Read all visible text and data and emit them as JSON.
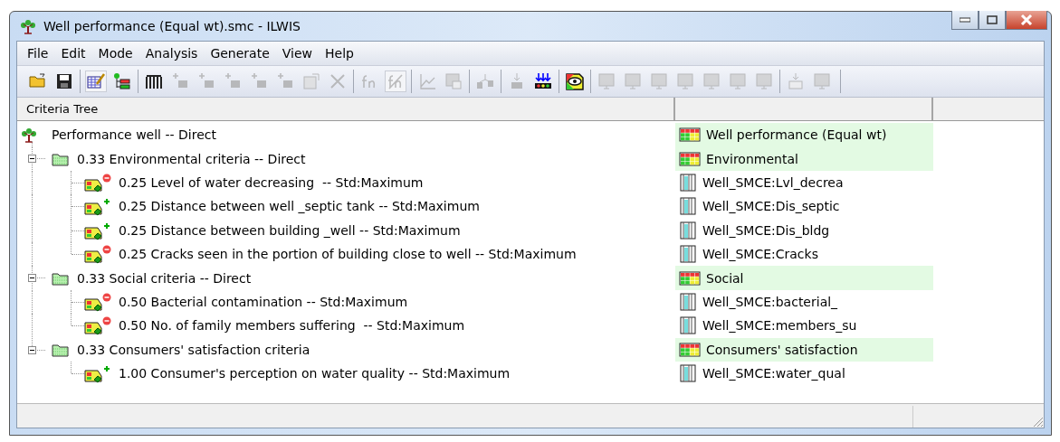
{
  "window": {
    "title": "Well performance (Equal wt).smc - ILWIS"
  },
  "menu": [
    "File",
    "Edit",
    "Mode",
    "Analysis",
    "Generate",
    "View",
    "Help"
  ],
  "toolbar": [
    {
      "buttons": [
        {
          "disabled": false,
          "pressed": false
        },
        {
          "disabled": false,
          "pressed": false
        }
      ]
    },
    {
      "buttons": [
        {
          "disabled": false,
          "pressed": true
        },
        {
          "disabled": false,
          "pressed": false
        }
      ]
    },
    {
      "buttons": [
        {
          "disabled": false,
          "pressed": false
        },
        {
          "disabled": true,
          "pressed": false
        },
        {
          "disabled": true,
          "pressed": false
        },
        {
          "disabled": true,
          "pressed": false
        },
        {
          "disabled": true,
          "pressed": false
        },
        {
          "disabled": true,
          "pressed": false
        },
        {
          "disabled": true,
          "pressed": false
        },
        {
          "disabled": true,
          "pressed": false
        }
      ]
    },
    {
      "buttons": [
        {
          "disabled": true,
          "pressed": false
        },
        {
          "disabled": true,
          "pressed": true
        }
      ]
    },
    {
      "buttons": [
        {
          "disabled": true,
          "pressed": false
        },
        {
          "disabled": true,
          "pressed": false
        }
      ]
    },
    {
      "buttons": [
        {
          "disabled": true,
          "pressed": false
        }
      ]
    },
    {
      "buttons": [
        {
          "disabled": true,
          "pressed": false
        },
        {
          "disabled": false,
          "pressed": false
        }
      ]
    },
    {
      "buttons": [
        {
          "disabled": false,
          "pressed": false
        }
      ]
    },
    {
      "buttons": [
        {
          "disabled": true,
          "pressed": false
        },
        {
          "disabled": true,
          "pressed": false
        },
        {
          "disabled": true,
          "pressed": false
        },
        {
          "disabled": true,
          "pressed": false
        },
        {
          "disabled": true,
          "pressed": false
        },
        {
          "disabled": true,
          "pressed": false
        },
        {
          "disabled": true,
          "pressed": false
        }
      ]
    },
    {
      "buttons": [
        {
          "disabled": true,
          "pressed": false
        },
        {
          "disabled": true,
          "pressed": false
        }
      ]
    }
  ],
  "columns": [
    "Criteria Tree"
  ],
  "tree": {
    "label": "Performance well -- Direct",
    "output": {
      "text": "Well performance (Equal wt)",
      "kind": "map"
    },
    "children": [
      {
        "label": "0.33 Environmental criteria -- Direct",
        "expanded": true,
        "output": {
          "text": "Environmental",
          "kind": "map"
        },
        "children": [
          {
            "label": "0.25 Level of water decreasing  -- Std:Maximum",
            "kind": "cost",
            "output": {
              "text": "Well_SMCE:Lvl_decrea",
              "kind": "column"
            }
          },
          {
            "label": "0.25 Distance between well _septic tank -- Std:Maximum",
            "kind": "benefit",
            "output": {
              "text": "Well_SMCE:Dis_septic",
              "kind": "column"
            }
          },
          {
            "label": "0.25 Distance between building _well -- Std:Maximum",
            "kind": "benefit",
            "output": {
              "text": "Well_SMCE:Dis_bldg",
              "kind": "column"
            }
          },
          {
            "label": "0.25 Cracks seen in the portion of building close to well -- Std:Maximum",
            "kind": "cost",
            "output": {
              "text": "Well_SMCE:Cracks",
              "kind": "column"
            }
          }
        ]
      },
      {
        "label": "0.33 Social criteria -- Direct",
        "expanded": true,
        "output": {
          "text": "Social",
          "kind": "map"
        },
        "children": [
          {
            "label": "0.50 Bacterial contamination -- Std:Maximum",
            "kind": "cost",
            "output": {
              "text": "Well_SMCE:bacterial_",
              "kind": "column"
            }
          },
          {
            "label": "0.50 No. of family members suffering  -- Std:Maximum",
            "kind": "cost",
            "output": {
              "text": "Well_SMCE:members_su",
              "kind": "column"
            }
          }
        ]
      },
      {
        "label": "0.33 Consumers' satisfaction criteria",
        "expanded": true,
        "output": {
          "text": "Consumers' satisfaction",
          "kind": "map"
        },
        "children": [
          {
            "label": "1.00 Consumer's perception on water quality -- Std:Maximum",
            "kind": "benefit",
            "output": {
              "text": "Well_SMCE:water_qual",
              "kind": "column"
            }
          }
        ]
      }
    ]
  }
}
